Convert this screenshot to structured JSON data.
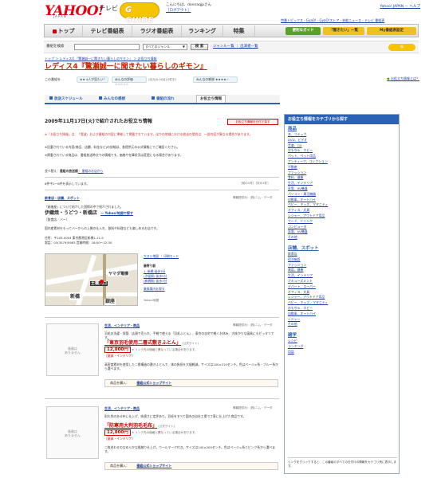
{
  "header": {
    "logo": "YAHOO!",
    "logo_sub": "JAPAN",
    "service": "テレビ",
    "gguide": "G GUIDE",
    "greeting": "こんにちは、donnaqjpさん",
    "logout": "［ログアウト］",
    "toplinks": "Yahoo! JAPAN － ヘルプ",
    "sublinks": "特番トピックス ‐ GyaO! ‐ GyaO!ストア ‐ 芸能ニュース ‐ テレビ 番組表"
  },
  "nav": {
    "tabs": [
      "トップ",
      "テレビ番組表",
      "ラジオ番組表",
      "ランキング",
      "特集"
    ],
    "promo": [
      "便利なガイド",
      "「聞きたい」一覧",
      "My番組表設定"
    ]
  },
  "search": {
    "label": "番組を検索",
    "genre": "すべてのジャンル",
    "button": "検 索",
    "links": "ジャンル一覧 ｜ 出演者一覧"
  },
  "breadcrumb": "トップ ＞ レディス4 『驚瀬誠一に聞きたい暮らしのギモン』 ＞ お役立ち情報",
  "program_title": "レディス4『驚瀬誠一に聞きたい暮らしのギモン』",
  "rating": {
    "label": "この番組を",
    "pill_a": "★★ 4人が見たい！",
    "pill_b": "みんなの評価 ☆☆☆☆☆",
    "pill_b_sub": "(手元(0.00点) 0件中)",
    "pill_c": "みんなの感想 ★★★★☆",
    "info_link": "お役立ち情報とは？"
  },
  "subtabs": [
    "放送スケジュール",
    "みんなの感想",
    "番組の流れ",
    "お役立ち情報"
  ],
  "date_heading": "2009年11月17日(火)で紹介されたお役立ち情報",
  "date_button": "お役立ち情報を日付で探す",
  "notes": [
    "※「お役立ち情報」は、「電波」および番組の内容に準拠して掲載されています。ほかの地域における放送の場合は、一部内容が異なる場合があります。",
    "※記載されている内容(商品、店舗、料金など)の詳細は、各提供元の公式情報にてご確認ください。",
    "※掲載されている商品は、番組放送時点での情報です。価格や在庫状況は変更になる場合があります。"
  ],
  "sort": {
    "label": "並べ替え：",
    "newest": "番組の放送順",
    "other": "｜ 番組のお店から"
  },
  "count": "6件中1〜6件を表示しています。",
  "page_nav": "［前の1件］［次の1件］",
  "item1": {
    "category": "飲食店・店舗、スポット",
    "provider": "情報提供元：(株)ニム・データ",
    "intro": "「越後屋」について紹介した国際の中で紹介されました。",
    "name": "伊織焼・うどつ・新橋店",
    "name_link": "～ Yahoo!地図で探す",
    "genre": "［飲食店／バー］",
    "desc": "国内産素材をもってバーからの上質の仕入れ、飲料や料理なども楽しめるお店です。",
    "address": "住所：〒105-0004 東京都港区新橋1-11-9",
    "tel": "電話：03(3579)5983 営業時間：18:00〜22:30",
    "map_links": "大きい地図 ｜ 印刷モード",
    "station_label": "最寄り駅",
    "stations": [
      "1. 新橋 徒歩3分",
      "(汐留駅) 徒歩5分",
      "(新橋駅) 徒歩7分"
    ],
    "route_link": "乗換案内を探す",
    "map_credit": "Yahoo!地図",
    "map_labels": [
      "新橋駅",
      "ヤマダ電機",
      "新橋",
      "土橋入口",
      "銀座"
    ]
  },
  "item2": {
    "noimg": "画像は\nありません",
    "category": "生活、インテリア・商品",
    "provider": "情報提供元：(株)ニム・データ",
    "intro": "羽毛の洗濯・保管、店頭で売られ、手軽で使える「羽毛ふとん」、東京の自宅で軽くお休み、大掛かりな寝具にもピッタリです。",
    "name": "「東京羽毛使用二層式敷きふとん」",
    "name_tag": "(公式サイト)",
    "price": "12,800円",
    "price_note": "※ リンク先の価格と異なっている場合があります。",
    "genre": "［寝具・インテリア］",
    "desc": "高密度素材を使用した二層構造の敷きふとんで、体の負担を大幅軽減。サイズは100×210センチ。色はベージュ系・ブルー系から選べます。",
    "buy_label": "商品を購入：",
    "buy_link": "番組公式ショップサイト"
  },
  "item3": {
    "noimg": "画像は\nありません",
    "category": "生活、インテリア・商品",
    "provider": "情報提供元：(株)ニム・データ",
    "intro": "耐久性のある布に仕上げ、快適さに定評あり。羽毛をすべて国内の自社工場で丁寧に仕上げた商品です。",
    "name": "「防寒用大判羽毛毛布」",
    "name_tag": "(公式サイト)",
    "price": "12,800円",
    "price_note": "※ リンク先の価格と異なっている場合があります。",
    "genre": "［寝具・インテリア］",
    "desc": "二枚合わせのなめらかな肌触り仕上げ。ウールマーク付き。サイズは140×200センチ。色はベージュ系とピンク系から選べます。",
    "buy_label": "商品を購入：",
    "buy_link": "番組公式ショップサイト"
  },
  "sidebar": {
    "title": "お役立ち情報をカテゴリから探す",
    "sections": [
      {
        "head": "商品",
        "items": [
          "本、コミック",
          "DVD、ビデオ",
          "音楽、CD",
          "おもちゃ、ホビー",
          "ペット、ペット用品",
          "アンティーク、コレクション",
          "不動産",
          "ファッション",
          "食料、健康",
          "生活、インテリア",
          "家電、AV機器",
          "パソコン・周辺機器",
          "自動車、オートバイ",
          "ベビー、キッズ、マタニティ",
          "オフィス、文具",
          "レジャー、アウトドア用品",
          "フード、ドリンク",
          "コンピュータ",
          "家電、AV機器",
          "その他"
        ]
      },
      {
        "head": "店舗、スポット",
        "items": [
          "飲食店",
          "宿泊施設",
          "ファッション",
          "美容、健康",
          "生活、インテリア",
          "アミューズメント",
          "デパート、スーパー",
          "オフィス、文具",
          "レジャー、アウトドア用品",
          "ベビー、キッズ、マタニティ",
          "おもちゃ、ホビー",
          "自動車、オートバイ",
          "レジャー",
          "その他"
        ]
      },
      {
        "head": "雑学",
        "items": [
          "レシピ",
          "ランキング",
          "用語"
        ]
      }
    ],
    "footer": "リンクをクリックすると、この番組のすべての日付けの情報をカテゴリ別に表示します。"
  }
}
